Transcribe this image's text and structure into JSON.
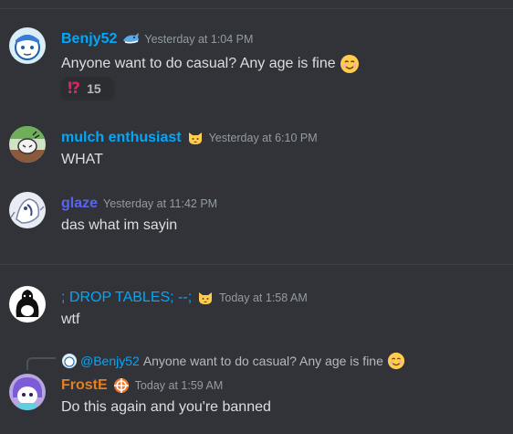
{
  "messages": [
    {
      "author": "Benjy52",
      "author_color": "#00a8fc",
      "tag_icon": "blue-shark-icon",
      "timestamp": "Yesterday at 1:04 PM",
      "text": "Anyone want to do casual? Any age is fine",
      "text_emoji": "smiling-face-icon",
      "reaction": {
        "emoji": "⁉",
        "emoji_name": "exclamation-question-icon",
        "count": "15"
      }
    },
    {
      "author": "mulch enthusiast",
      "author_color": "#00a8fc",
      "tag_icon": "cat-face-icon",
      "timestamp": "Yesterday at 6:10 PM",
      "text": "WHAT"
    },
    {
      "author": "glaze",
      "author_color": "#5865f2",
      "timestamp": "Yesterday at 11:42 PM",
      "text": "das what im sayin"
    },
    {
      "author": "; DROP TABLES; --;",
      "author_color": "#00a8fc",
      "tag_icon": "cat-face-icon",
      "timestamp": "Today at 1:58 AM",
      "text": "wtf"
    },
    {
      "reply_to": {
        "author": "@Benjy52",
        "text": "Anyone want to do casual? Any age is fine"
      },
      "author": "FrostE",
      "author_color": "#e67e22",
      "tag_icon": "crosshair-icon",
      "timestamp": "Today at 1:59 AM",
      "text": "Do this again and you're banned"
    }
  ],
  "colors": {
    "background": "#313338",
    "divider": "#3f4147",
    "text": "#dbdee1",
    "timestamp": "#949ba4"
  }
}
